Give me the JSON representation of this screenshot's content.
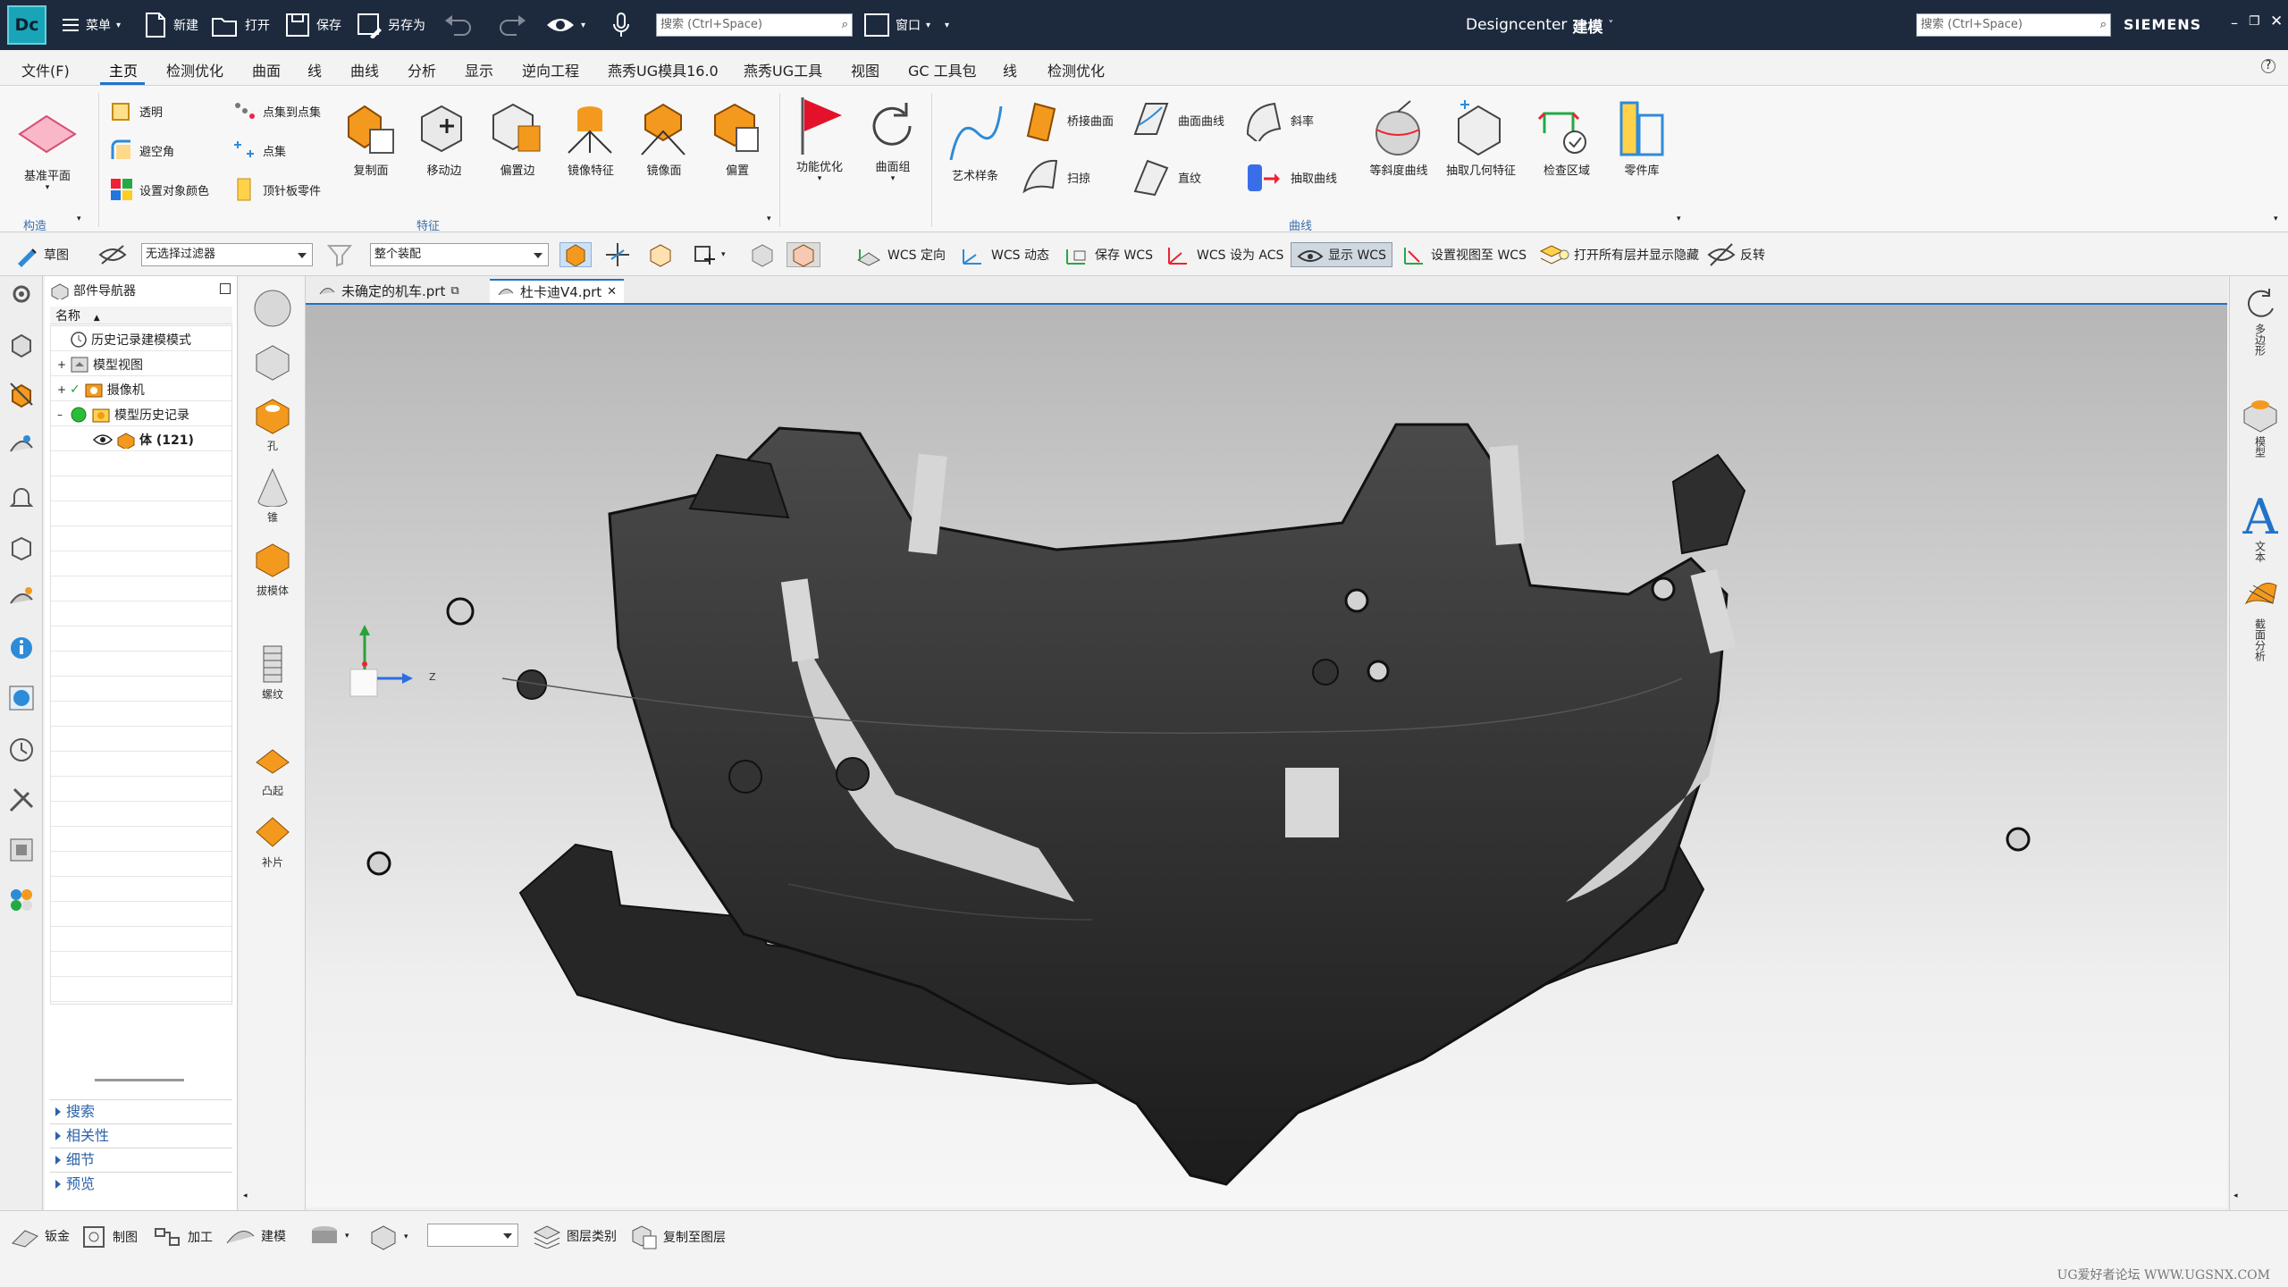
{
  "title_bar": {
    "app_logo": "Dc",
    "menu": "菜单",
    "new": "新建",
    "open": "打开",
    "save": "保存",
    "save_as": "另存为",
    "window": "窗口",
    "search_left_placeholder": "搜索 (Ctrl+Space)",
    "app_title": "Designcenter",
    "app_mode": "建模",
    "search_right_placeholder": "搜索 (Ctrl+Space)",
    "brand": "SIEMENS"
  },
  "menubar": {
    "file": "文件(F)",
    "tabs": [
      "主页",
      "检测优化",
      "曲面",
      "线",
      "曲线",
      "分析",
      "显示",
      "逆向工程",
      "燕秀UG模具16.0",
      "燕秀UG工具",
      "视图",
      "GC 工具包",
      "线",
      "检测优化"
    ],
    "help": "?"
  },
  "ribbon": {
    "groups": {
      "construct": "构造",
      "feature": "特征",
      "curve": "曲线"
    },
    "datum_plane": "基准平面",
    "small": {
      "transparent": "透明",
      "avoid_corner": "避空角",
      "set_color": "设置对象颜色",
      "point_to_point": "点集到点集",
      "point_set": "点集",
      "top_plate": "顶针板零件"
    },
    "feature_buttons": [
      "复制面",
      "移动边",
      "偏置边",
      "镜像特征",
      "镜像面",
      "偏置"
    ],
    "function_opt": "功能优化",
    "surface_group": "曲面组",
    "art_spline": "艺术样条",
    "curve_small": {
      "bridge_surface": "桥接曲面",
      "sweep": "扫掠",
      "surface_curve": "曲面曲线",
      "ruled": "直纹",
      "slope": "斜率",
      "extract_curve": "抽取曲线"
    },
    "curve_buttons": [
      "等斜度曲线",
      "抽取几何特征",
      "检查区域",
      "零件库"
    ]
  },
  "toolbar2": {
    "sketch": "草图",
    "filter": "无选择过滤器",
    "assembly": "整个装配",
    "wcs_orient": "WCS 定向",
    "wcs_dynamic": "WCS 动态",
    "save_wcs": "保存 WCS",
    "wcs_to_acs": "WCS 设为 ACS",
    "show_wcs": "显示 WCS",
    "set_view_wcs": "设置视图至 WCS",
    "open_layers": "打开所有层并显示隐藏",
    "reverse": "反转"
  },
  "navigator": {
    "title": "部件导航器",
    "column": "名称",
    "rows": [
      "历史记录建模模式",
      "模型视图",
      "摄像机",
      "模型历史记录",
      "体 (121)"
    ],
    "sections": [
      "搜索",
      "相关性",
      "细节",
      "预览"
    ]
  },
  "vtoolbar": [
    "孔",
    "锥",
    "拔模体",
    "螺纹",
    "凸起",
    "补片"
  ],
  "tabs": [
    "未确定的机车.prt",
    "杜卡迪V4.prt"
  ],
  "right_bar": [
    "多边形",
    "模型",
    "文本",
    "截面分析"
  ],
  "triad": {
    "z_label": "Z"
  },
  "statusbar": {
    "sheet_metal": "钣金",
    "drawing": "制图",
    "machining": "加工",
    "modeling": "建模",
    "layer_category": "图层类别",
    "copy_to_layer": "复制至图层"
  },
  "watermark": "UG爱好者论坛 WWW.UGSNX.COM",
  "colors": {
    "accent": "#2173c9",
    "titlebar": "#1d2a3e",
    "orange": "#f39a1e"
  }
}
